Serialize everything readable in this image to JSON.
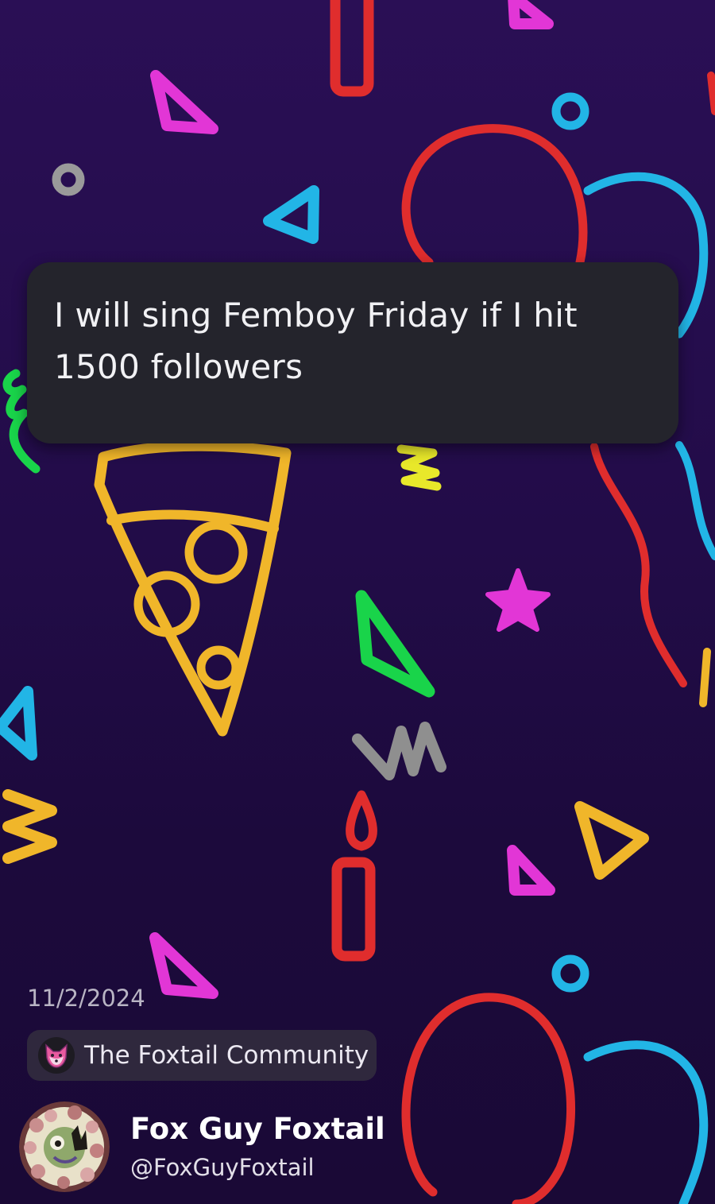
{
  "post": {
    "text": "I will sing Femboy Friday if I hit\n1500 followers",
    "date": "11/2/2024"
  },
  "community": {
    "name": "The Foxtail Community",
    "icon": "fox-icon"
  },
  "author": {
    "display_name": "Fox Guy Foxtail",
    "handle": "@FoxGuyFoxtail",
    "avatar_icon": "fox-avatar"
  },
  "background": {
    "theme": "neon party doodles",
    "colors": [
      "#2a0f55",
      "#e02d2d",
      "#22b5e6",
      "#e236d6",
      "#f0b62a",
      "#19d44a",
      "#e8e82a",
      "#8f8f8f"
    ]
  }
}
